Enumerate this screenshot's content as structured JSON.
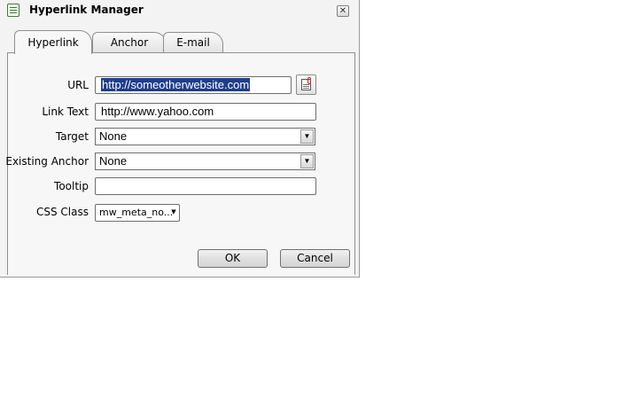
{
  "window": {
    "title": "Hyperlink Manager",
    "close_glyph": "✕"
  },
  "tabs": [
    {
      "label": "Hyperlink",
      "active": true
    },
    {
      "label": "Anchor",
      "active": false
    },
    {
      "label": "E-mail",
      "active": false
    }
  ],
  "form": {
    "url": {
      "label": "URL",
      "value": "http://someotherwebsite.com",
      "selected": true
    },
    "link_text": {
      "label": "Link Text",
      "value": "http://www.yahoo.com"
    },
    "target": {
      "label": "Target",
      "value": "None"
    },
    "existing_anchor": {
      "label": "Existing Anchor",
      "value": "None"
    },
    "tooltip": {
      "label": "Tooltip",
      "value": ""
    },
    "css_class": {
      "label": "CSS Class",
      "value": "mw_meta_no..."
    }
  },
  "buttons": {
    "ok": "OK",
    "cancel": "Cancel"
  },
  "icons": {
    "app": "document-icon",
    "browse": "document-link-icon",
    "dropdown": "▼"
  }
}
